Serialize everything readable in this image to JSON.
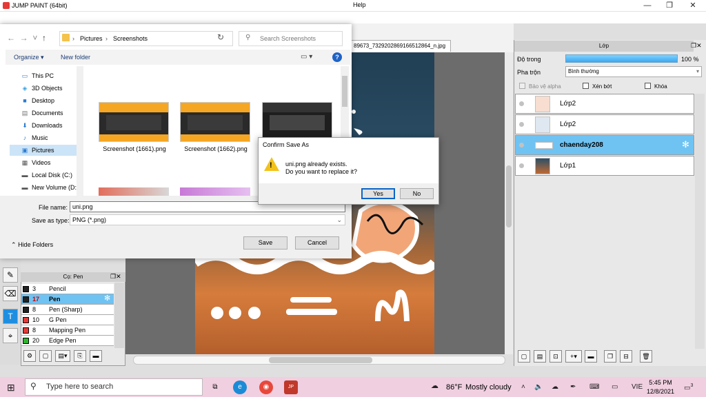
{
  "app": {
    "title": "JUMP PAINT (64bit)",
    "menu_help": "Help",
    "doc_tab": "89673_7329202869166512864_n.jpg"
  },
  "window_controls": {
    "minimize": "—",
    "maximize": "❐",
    "close": "✕"
  },
  "brush_panel": {
    "title": "Cọ: Pen",
    "items": [
      {
        "num": "3",
        "name": "Pencil",
        "color": "#222222"
      },
      {
        "num": "17",
        "name": "Pen",
        "color": "#222222",
        "selected": true
      },
      {
        "num": "8",
        "name": "Pen (Sharp)",
        "color": "#222222"
      },
      {
        "num": "10",
        "name": "G Pen",
        "color": "#e53935"
      },
      {
        "num": "8",
        "name": "Mapping Pen",
        "color": "#e53935"
      },
      {
        "num": "20",
        "name": "Edge Pen",
        "color": "#2db52d"
      }
    ]
  },
  "layer_panel": {
    "title": "Lớp",
    "opacity_label": "Độ trong",
    "opacity_value": "100 %",
    "blend_label": "Pha trộn",
    "blend_value": "Bình thường",
    "lock_alpha": "Bảo vệ alpha",
    "clipping": "Xén bớt",
    "lock": "Khóa",
    "layers": [
      {
        "name": "Lớp2",
        "selected": false
      },
      {
        "name": "Lớp2",
        "selected": false
      },
      {
        "name": "chaenday208",
        "selected": true
      },
      {
        "name": "Lớp1",
        "selected": false
      }
    ]
  },
  "file_dialog": {
    "breadcrumb": [
      "Pictures",
      "Screenshots"
    ],
    "search_placeholder": "Search Screenshots",
    "organize": "Organize ▾",
    "new_folder": "New folder",
    "nav_items": [
      {
        "label": "This PC",
        "icon": "pc-icon"
      },
      {
        "label": "3D Objects",
        "icon": "cube-icon"
      },
      {
        "label": "Desktop",
        "icon": "desktop-icon"
      },
      {
        "label": "Documents",
        "icon": "document-icon"
      },
      {
        "label": "Downloads",
        "icon": "download-icon"
      },
      {
        "label": "Music",
        "icon": "music-icon"
      },
      {
        "label": "Pictures",
        "icon": "pictures-icon",
        "selected": true
      },
      {
        "label": "Videos",
        "icon": "video-icon"
      },
      {
        "label": "Local Disk (C:)",
        "icon": "disk-icon"
      },
      {
        "label": "New Volume (D:",
        "icon": "disk-icon"
      }
    ],
    "files": [
      "Screenshot (1661).png",
      "Screenshot (1662).png"
    ],
    "file_name_label": "File name:",
    "file_name_value": "uni.png",
    "save_type_label": "Save as type:",
    "save_type_value": "PNG (*.png)",
    "hide_folders": "Hide Folders",
    "save": "Save",
    "cancel": "Cancel"
  },
  "confirm": {
    "title": "Confirm Save As",
    "line1": "uni.png already exists.",
    "line2": "Do you want to replace it?",
    "yes": "Yes",
    "no": "No"
  },
  "taskbar": {
    "search_placeholder": "Type here to search",
    "temp": "86°F",
    "condition": "Mostly cloudy",
    "lang": "VIE",
    "time": "5:45 PM",
    "date": "12/8/2021",
    "notif_count": "3"
  }
}
